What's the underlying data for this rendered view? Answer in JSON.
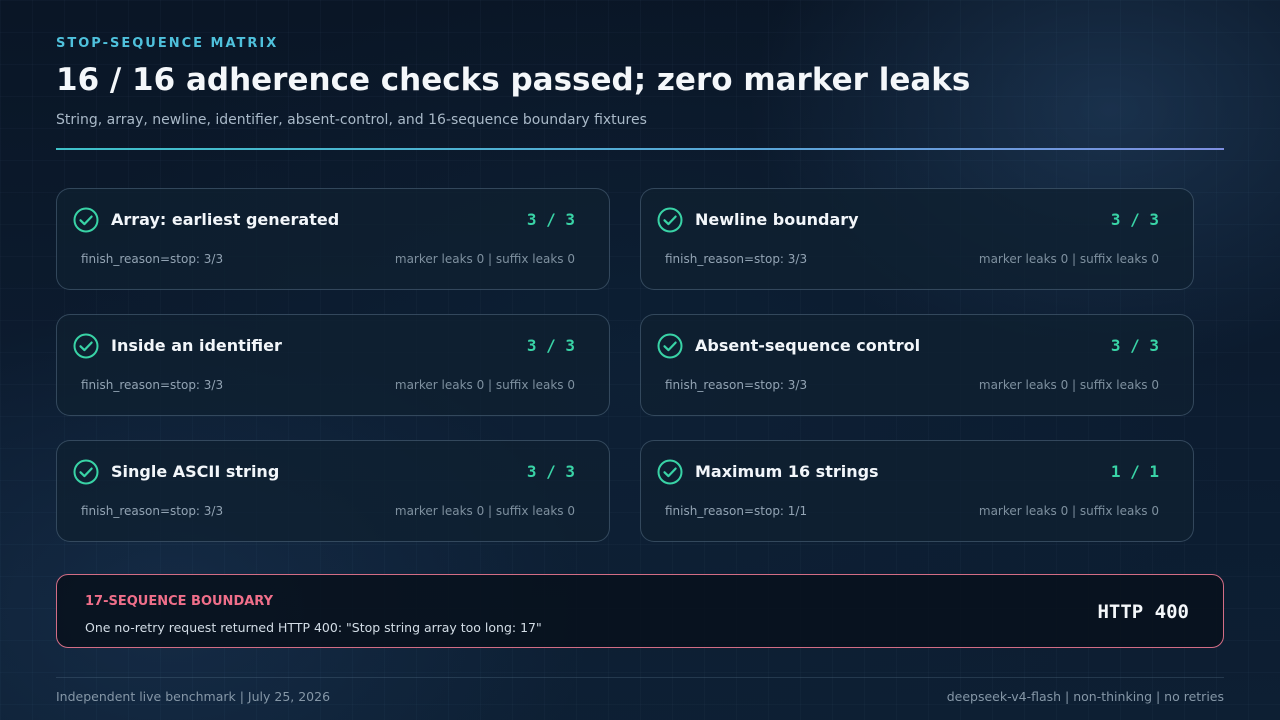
{
  "header": {
    "eyebrow": "STOP-SEQUENCE MATRIX",
    "title": "16 / 16 adherence checks passed; zero marker leaks",
    "subtitle": "String, array, newline, identifier, absent-control, and 16-sequence boundary fixtures"
  },
  "colors": {
    "accent": "#4fc1dc",
    "pass": "#39d3a6",
    "boundary": "#f06f8a"
  },
  "cards": [
    {
      "icon": "check-circle-icon",
      "title": "Array: earliest generated",
      "score": "3 / 3",
      "finish": "finish_reason=stop: 3/3",
      "leaks": "marker leaks 0 | suffix leaks 0"
    },
    {
      "icon": "check-circle-icon",
      "title": "Newline boundary",
      "score": "3 / 3",
      "finish": "finish_reason=stop: 3/3",
      "leaks": "marker leaks 0 | suffix leaks 0"
    },
    {
      "icon": "check-circle-icon",
      "title": "Inside an identifier",
      "score": "3 / 3",
      "finish": "finish_reason=stop: 3/3",
      "leaks": "marker leaks 0 | suffix leaks 0"
    },
    {
      "icon": "check-circle-icon",
      "title": "Absent-sequence control",
      "score": "3 / 3",
      "finish": "finish_reason=stop: 3/3",
      "leaks": "marker leaks 0 | suffix leaks 0"
    },
    {
      "icon": "check-circle-icon",
      "title": "Single ASCII string",
      "score": "3 / 3",
      "finish": "finish_reason=stop: 3/3",
      "leaks": "marker leaks 0 | suffix leaks 0"
    },
    {
      "icon": "check-circle-icon",
      "title": "Maximum 16 strings",
      "score": "1 / 1",
      "finish": "finish_reason=stop: 1/1",
      "leaks": "marker leaks 0 | suffix leaks 0"
    }
  ],
  "boundary": {
    "label": "17-SEQUENCE BOUNDARY",
    "description": "One no-retry request returned HTTP 400: \"Stop string array too long: 17\"",
    "status": "HTTP 400"
  },
  "footer": {
    "left": "Independent live benchmark | July 25, 2026",
    "right": "deepseek-v4-flash | non-thinking | no retries"
  }
}
